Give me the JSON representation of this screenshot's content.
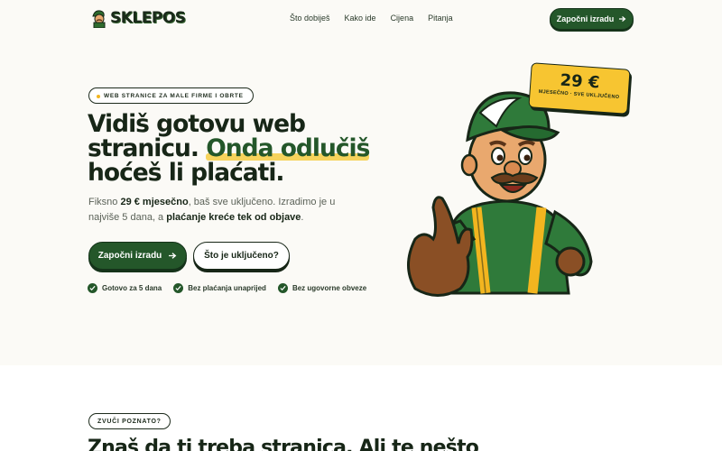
{
  "brand": {
    "name": "SKLEPOS"
  },
  "nav": {
    "links": [
      "Što dobiješ",
      "Kako ide",
      "Cijena",
      "Pitanja"
    ],
    "cta_label": "Započni izradu"
  },
  "hero": {
    "pill": "WEB STRANICE ZA MALE FIRME I OBRTE",
    "headline_line1": "Vidiš gotovu web",
    "headline_line2_a": "stranicu. ",
    "headline_line2_highlight": "Onda odlučiš",
    "headline_line3": "hoćeš li plaćati.",
    "lead_1": "Fiksno ",
    "lead_bold_1": "29 € mjesečno",
    "lead_2": ", baš sve uključeno. Izradimo je u najviše 5 dana, a ",
    "lead_bold_2": "plaćanje kreće tek od objave",
    "lead_3": ".",
    "primary_button": "Započni izradu",
    "secondary_button": "Što je uključeno?",
    "checks": [
      "Gotovo za 5 dana",
      "Bez plaćanja unaprijed",
      "Bez ugovorne obveze"
    ]
  },
  "price_badge": {
    "value": "29 €",
    "subtitle": "MJESEČNO · SVE UKLJUČENO"
  },
  "section2": {
    "pill": "ZVUČI POZNATO?",
    "headline": "Znaš da ti treba stranica. Ali te nešto"
  },
  "colors": {
    "brand_green": "#24572a",
    "accent_yellow": "#f7c531",
    "background": "#fbfaf6"
  },
  "icons": {
    "arrow": "arrow-right-icon",
    "check": "check-circle-icon"
  }
}
